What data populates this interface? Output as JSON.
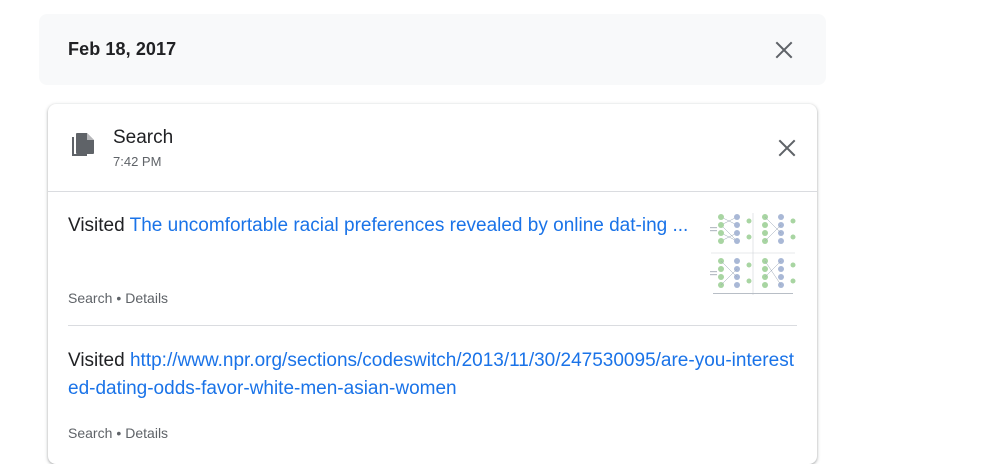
{
  "date_group": {
    "title": "Feb 18, 2017"
  },
  "card": {
    "title": "Search",
    "time": "7:42 PM",
    "entries": [
      {
        "prefix": "Visited",
        "link_text": "The uncomfortable racial preferences revealed by online dat-ing ...",
        "meta_source": "Search",
        "meta_separator": "•",
        "meta_details": "Details"
      },
      {
        "prefix": "Visited",
        "link_text": "http://www.npr.org/sections/codeswitch/2013/11/30/247530095/are-you-interested-dating-odds-favor-white-men-asian-women",
        "meta_source": "Search",
        "meta_separator": "•",
        "meta_details": "Details"
      }
    ]
  },
  "colors": {
    "link": "#1a73e8",
    "text": "#202124",
    "secondary": "#5f6368",
    "date_bar_bg": "#f8f9fa",
    "divider": "#dadce0"
  },
  "icons": {
    "date_close": "close-icon",
    "card_close": "close-icon",
    "card_type": "file-copy-icon"
  }
}
